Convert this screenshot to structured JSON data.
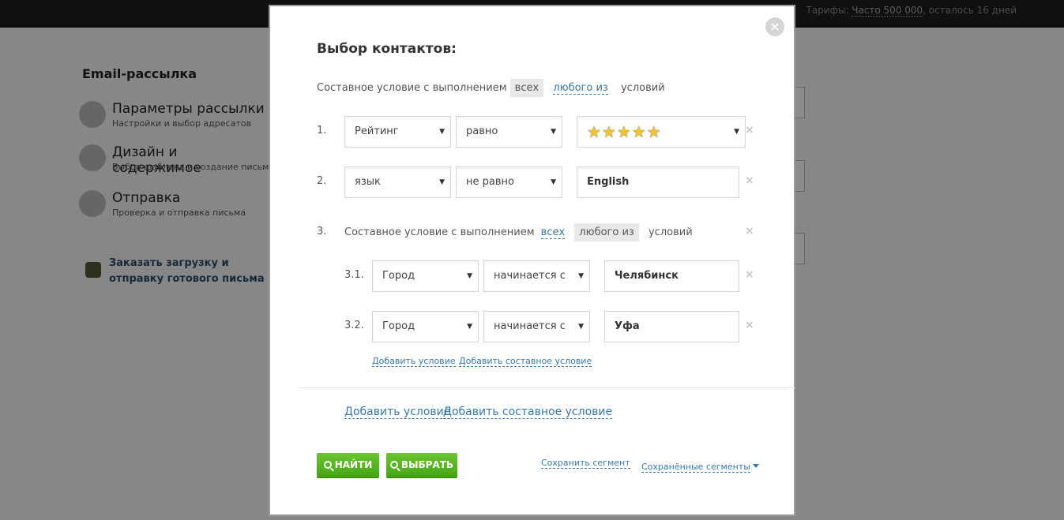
{
  "background": {
    "tariff_label": "Тарифы:",
    "tariff_value": "Часто 500 000",
    "tariff_rest": ", осталось 16 дней",
    "sidebar_title": "Email-рассылка",
    "steps": [
      {
        "title": "Параметры рассылки",
        "subtitle": "Настройки и выбор адресатов"
      },
      {
        "title": "Дизайн и содержимое",
        "subtitle": "Выбор шаблона и создание письма"
      },
      {
        "title": "Отправка",
        "subtitle": "Проверка и отправка письма"
      }
    ],
    "order_link": "Заказать загрузку и отправку готового письма"
  },
  "modal": {
    "title": "Выбор контактов:",
    "close_icon": "×",
    "root_condition": {
      "prefix": "Составное условие с выполнением",
      "all": "всех",
      "any": "любого из",
      "suffix": "условий",
      "selected": "all"
    },
    "conditions": [
      {
        "num": "1.",
        "field": "Рейтинг",
        "operator": "равно",
        "value_type": "stars",
        "value": 5
      },
      {
        "num": "2.",
        "field": "язык",
        "operator": "не равно",
        "value": "English"
      }
    ],
    "nested": {
      "num": "3.",
      "prefix": "Составное условие с выполнением",
      "all": "всех",
      "any": "любого из",
      "suffix": "условий",
      "selected": "any",
      "conditions": [
        {
          "num": "3.1.",
          "field": "Город",
          "operator": "начинается с",
          "value": "Челябинск"
        },
        {
          "num": "3.2.",
          "field": "Город",
          "operator": "начинается с",
          "value": "Уфа"
        }
      ],
      "add_condition": "Добавить условие",
      "add_compound": "Добавить составное условие"
    },
    "add_condition": "Добавить условие",
    "add_compound": "Добавить составное условие",
    "find_button": "НАЙТИ",
    "select_button": "ВЫБРАТЬ",
    "save_segment": "Сохранить сегмент",
    "saved_segments": "Сохранённые сегменты",
    "remove_icon": "×",
    "dropdown_arrow": "▼",
    "stars": "★★★★★"
  }
}
